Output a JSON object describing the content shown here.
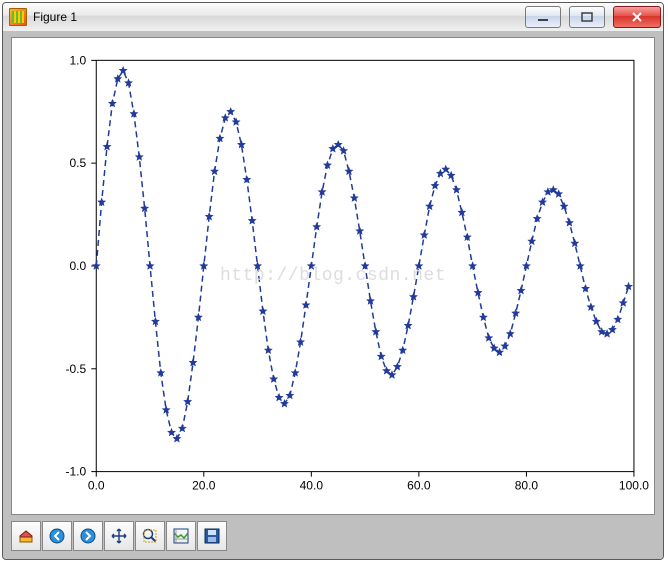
{
  "window": {
    "title": "Figure 1"
  },
  "watermark": "http://blog.csdn.net",
  "toolbar": {
    "home": "home-icon",
    "back": "arrow-left-icon",
    "forward": "arrow-right-icon",
    "pan": "move-icon",
    "zoom": "zoom-icon",
    "subplots": "subplots-icon",
    "save": "save-icon"
  },
  "chart_data": {
    "type": "line",
    "title": "",
    "xlabel": "",
    "ylabel": "",
    "xlim": [
      0,
      100
    ],
    "ylim": [
      -1.0,
      1.0
    ],
    "xticks": [
      0.0,
      20.0,
      40.0,
      60.0,
      80.0,
      100.0
    ],
    "yticks": [
      -1.0,
      -0.5,
      0.0,
      0.5,
      1.0
    ],
    "line_style": "dashed",
    "marker": "star",
    "color": "#223a9a",
    "x": [
      0,
      1,
      2,
      3,
      4,
      5,
      6,
      7,
      8,
      9,
      10,
      11,
      12,
      13,
      14,
      15,
      16,
      17,
      18,
      19,
      20,
      21,
      22,
      23,
      24,
      25,
      26,
      27,
      28,
      29,
      30,
      31,
      32,
      33,
      34,
      35,
      36,
      37,
      38,
      39,
      40,
      41,
      42,
      43,
      44,
      45,
      46,
      47,
      48,
      49,
      50,
      51,
      52,
      53,
      54,
      55,
      56,
      57,
      58,
      59,
      60,
      61,
      62,
      63,
      64,
      65,
      66,
      67,
      68,
      69,
      70,
      71,
      72,
      73,
      74,
      75,
      76,
      77,
      78,
      79,
      80,
      81,
      82,
      83,
      84,
      85,
      86,
      87,
      88,
      89,
      90,
      91,
      92,
      93,
      94,
      95,
      96,
      97,
      98,
      99
    ],
    "y": [
      0.0,
      0.31,
      0.58,
      0.79,
      0.91,
      0.95,
      0.89,
      0.74,
      0.53,
      0.28,
      0.0,
      -0.27,
      -0.52,
      -0.7,
      -0.81,
      -0.84,
      -0.79,
      -0.66,
      -0.47,
      -0.25,
      0.0,
      0.24,
      0.46,
      0.62,
      0.72,
      0.75,
      0.7,
      0.59,
      0.42,
      0.22,
      0.0,
      -0.22,
      -0.41,
      -0.55,
      -0.64,
      -0.67,
      -0.63,
      -0.52,
      -0.37,
      -0.19,
      0.0,
      0.19,
      0.36,
      0.49,
      0.57,
      0.59,
      0.56,
      0.46,
      0.33,
      0.17,
      0.0,
      -0.17,
      -0.32,
      -0.44,
      -0.51,
      -0.53,
      -0.49,
      -0.41,
      -0.29,
      -0.15,
      0.0,
      0.15,
      0.29,
      0.39,
      0.45,
      0.47,
      0.44,
      0.37,
      0.26,
      0.14,
      0.0,
      -0.13,
      -0.25,
      -0.35,
      -0.4,
      -0.42,
      -0.39,
      -0.33,
      -0.23,
      -0.12,
      0.0,
      0.12,
      0.23,
      0.31,
      0.36,
      0.37,
      0.35,
      0.29,
      0.21,
      0.11,
      0.0,
      -0.11,
      -0.2,
      -0.27,
      -0.32,
      -0.33,
      -0.31,
      -0.26,
      -0.18,
      -0.1
    ]
  }
}
